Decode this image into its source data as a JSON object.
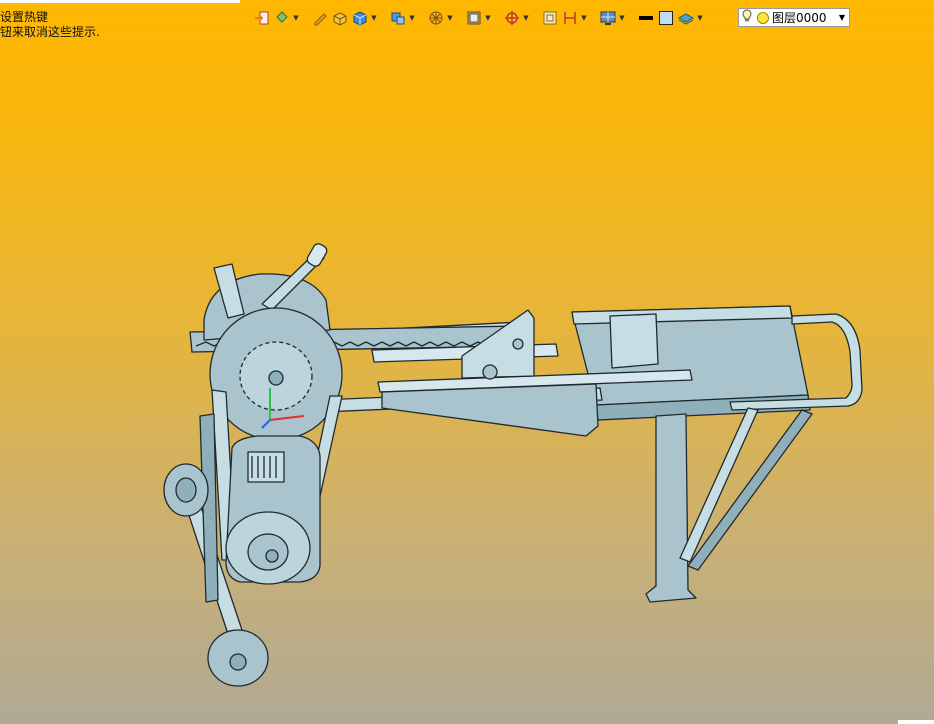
{
  "hint": {
    "line1": "设置热键",
    "line2": "钮来取消这些提示."
  },
  "toolbar": {
    "icons": [
      "import-icon",
      "paint-bucket-icon",
      "pencil-icon",
      "render-box-icon",
      "shaded-cube-icon",
      "view-cube-icon",
      "wireframe-sphere-icon",
      "display-mode-icon",
      "snap-target-icon",
      "frame-icon",
      "dimension-icon",
      "monitor-grid-icon",
      "line-color-swatch-icon",
      "fill-color-swatch-icon",
      "layer-shape-icon"
    ]
  },
  "layer": {
    "name": "图层0000"
  },
  "colors": {
    "background_top": "#ffb700",
    "background_bottom": "#b0a995",
    "model_fill": "#a9c4cc",
    "model_edge": "#1e2a2e"
  }
}
